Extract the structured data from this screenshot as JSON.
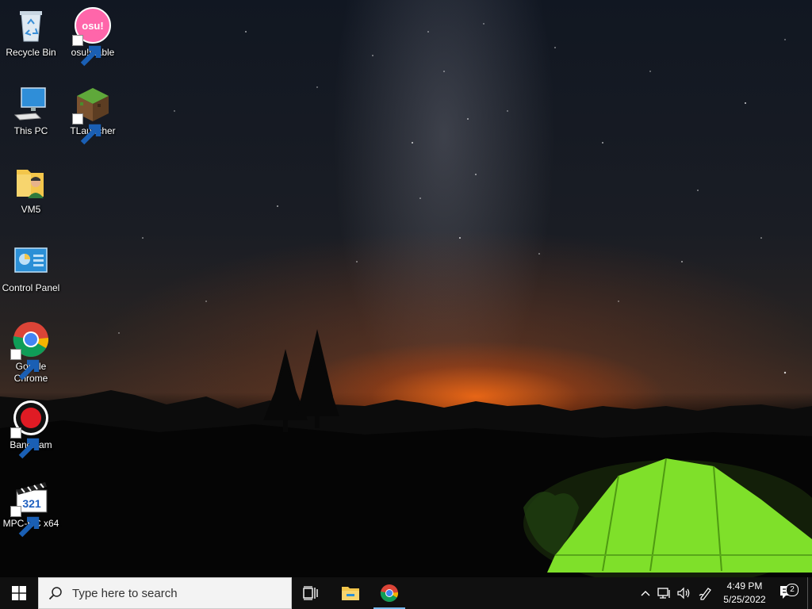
{
  "desktop": {
    "icons": [
      {
        "label": "Recycle Bin",
        "icon": "recycle-bin-icon"
      },
      {
        "label": "osu!stable",
        "icon": "osu-icon",
        "badge_text": "osu!"
      },
      {
        "label": "This PC",
        "icon": "computer-icon"
      },
      {
        "label": "TLauncher",
        "icon": "minecraft-block-icon"
      },
      {
        "label": "VM5",
        "icon": "user-folder-icon"
      },
      {
        "label": "Control Panel",
        "icon": "control-panel-icon"
      },
      {
        "label": "Google Chrome",
        "icon": "chrome-icon"
      },
      {
        "label": "Bandicam",
        "icon": "bandicam-record-icon"
      },
      {
        "label": "MPC-HC x64",
        "icon": "mpc-hc-clapper-icon",
        "badge_text": "321"
      }
    ]
  },
  "taskbar": {
    "search_placeholder": "Type here to search",
    "pinned": [
      {
        "name": "Task View",
        "icon": "task-view-icon"
      },
      {
        "name": "File Explorer",
        "icon": "file-explorer-icon"
      },
      {
        "name": "Google Chrome",
        "icon": "chrome-icon",
        "active": true
      }
    ],
    "tray": {
      "time": "4:49 PM",
      "date": "5/25/2022",
      "notification_count": "2"
    }
  },
  "colors": {
    "taskbar_bg": "#101010",
    "active_indicator": "#76b9ed",
    "tent_green": "#7fe02a",
    "horizon_orange": "#ff6e14"
  }
}
